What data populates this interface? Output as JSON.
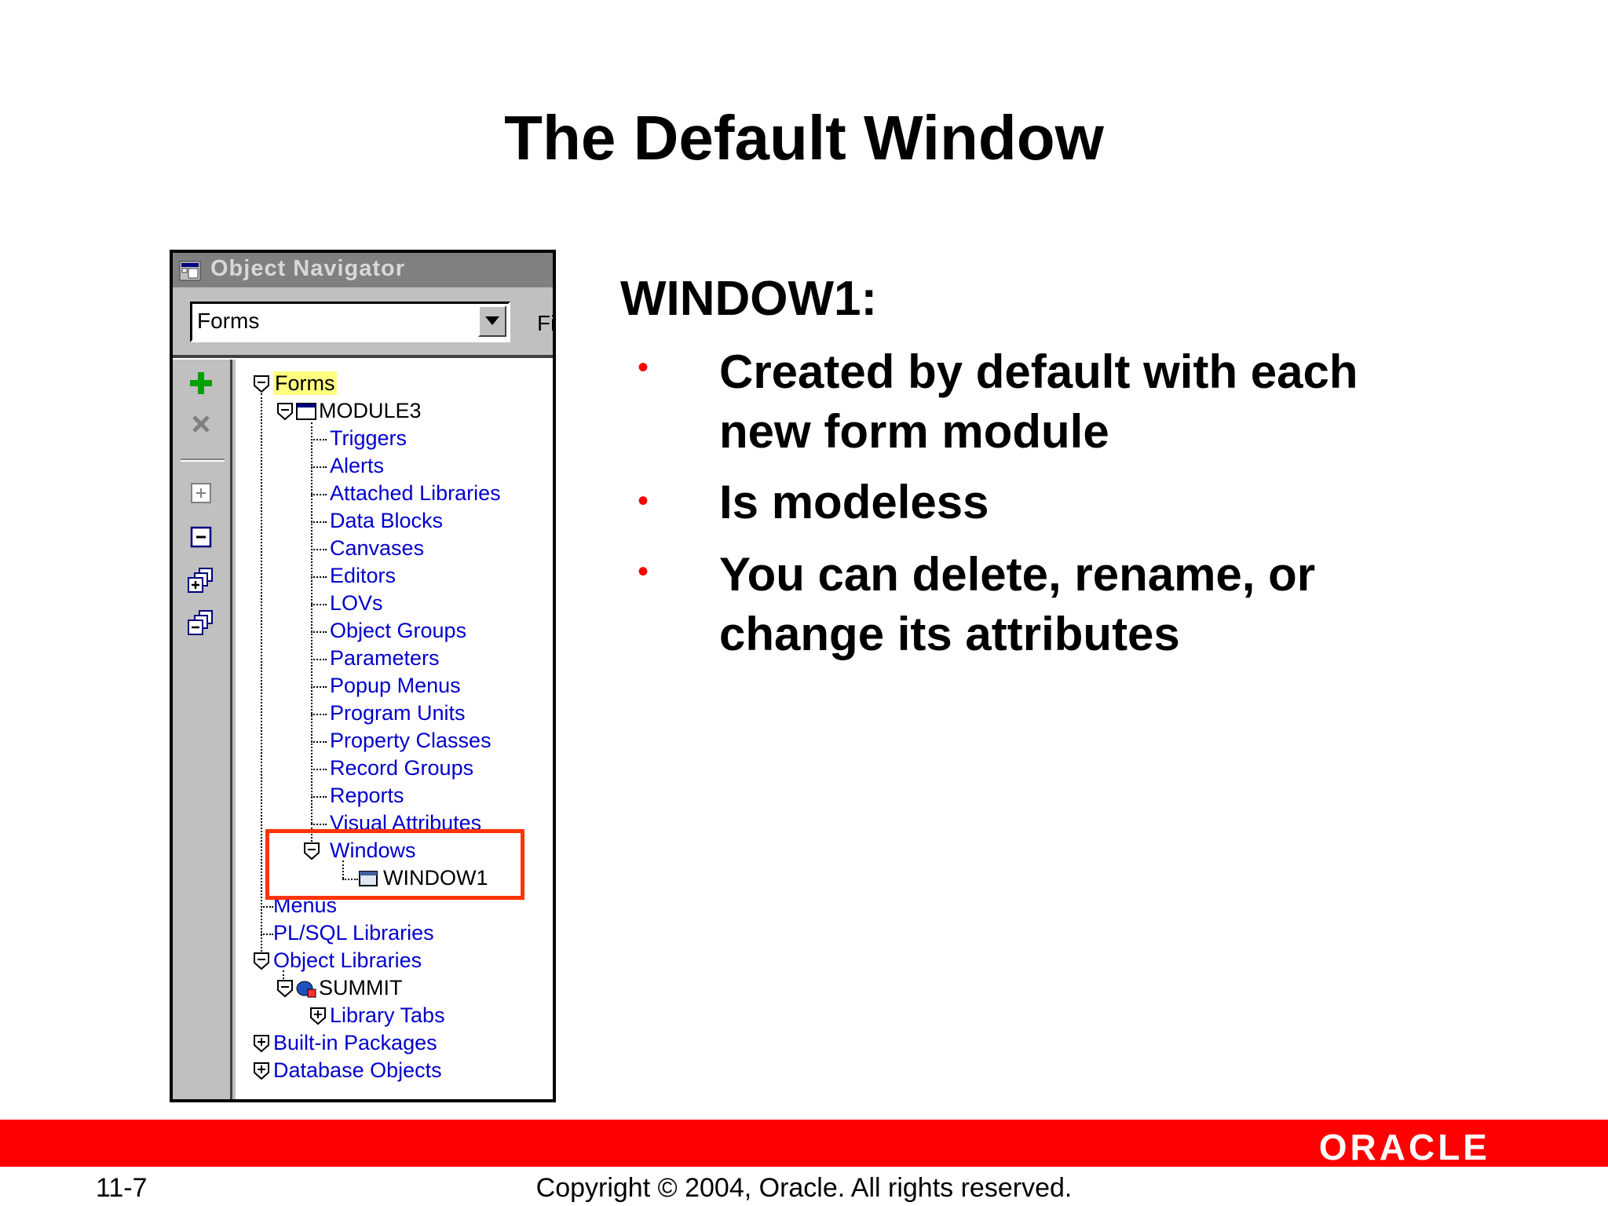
{
  "slide": {
    "title": "The Default Window",
    "page_number": "11-7",
    "copyright": "Copyright © 2004, Oracle.  All rights reserved.",
    "logo_text": "ORACLE"
  },
  "navigator": {
    "title": "Object Navigator",
    "combo_value": "Forms",
    "find_label": "Fi",
    "toolbar_icons": [
      "create-icon",
      "delete-icon",
      "expand-icon",
      "collapse-icon",
      "expand-all-icon",
      "collapse-all-icon"
    ],
    "tree": {
      "forms": "Forms",
      "module": "MODULE3",
      "module_children": [
        "Triggers",
        "Alerts",
        "Attached Libraries",
        "Data Blocks",
        "Canvases",
        "Editors",
        "LOVs",
        "Object Groups",
        "Parameters",
        "Popup Menus",
        "Program Units",
        "Property Classes",
        "Record Groups",
        "Reports",
        "Visual Attributes"
      ],
      "windows": "Windows",
      "window1": "WINDOW1",
      "menus": "Menus",
      "plsql_libraries": "PL/SQL Libraries",
      "object_libraries": "Object Libraries",
      "summit": "SUMMIT",
      "library_tabs": "Library Tabs",
      "builtin_packages": "Built-in Packages",
      "database_objects": "Database Objects"
    }
  },
  "content": {
    "heading": "WINDOW1:",
    "bullets": [
      [
        "Created by default with each",
        "new form module"
      ],
      [
        "Is modeless"
      ],
      [
        "You can delete, rename, or",
        "change its attributes"
      ]
    ],
    "bullet_glyph": "•"
  },
  "colors": {
    "footer_bar": "#ff0000",
    "highlight_box": "#ff3300",
    "tree_link": "#0000cc",
    "window_gray": "#c0c0c0"
  }
}
